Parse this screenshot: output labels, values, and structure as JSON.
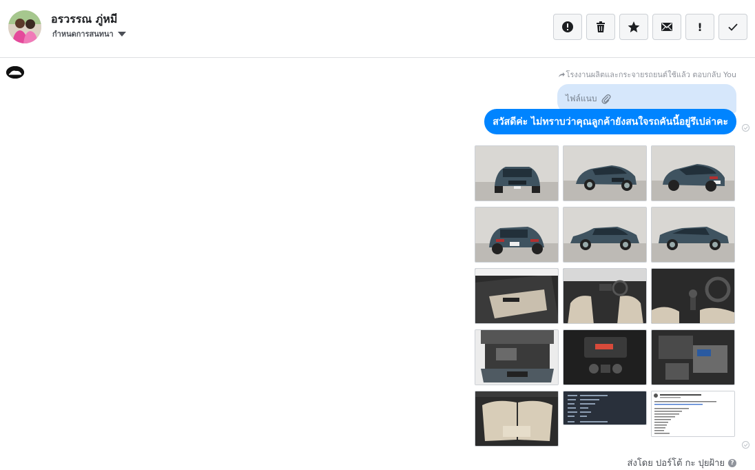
{
  "header": {
    "contact_name": "อรวรรณ ภู่หมี",
    "assign_label": "กำหนดการสนทนา",
    "toolbar": [
      {
        "icon": "alert-circle-icon",
        "name": "spam-button"
      },
      {
        "icon": "trash-icon",
        "name": "delete-button"
      },
      {
        "icon": "star-icon",
        "name": "star-button"
      },
      {
        "icon": "envelope-icon",
        "name": "mark-unread-button"
      },
      {
        "icon": "exclamation-icon",
        "name": "follow-up-button"
      },
      {
        "icon": "check-icon",
        "name": "mark-done-button"
      }
    ]
  },
  "thread": {
    "reply_note": "โรงงานผลิตและกระจายรถยนต์ใช้แล้ว ตอบกลับ You",
    "attachment_label": "ไฟล์แนบ",
    "message_text": "สวัสดีค่ะ ไม่ทราบว่าคุณลูกค้ายังสนใจรถคันนี้อยู่รึเปล่าคะ",
    "photos": [
      {
        "icon": "car-front-photo"
      },
      {
        "icon": "car-front-angle-photo"
      },
      {
        "icon": "car-rear-angle-photo"
      },
      {
        "icon": "car-rear-photo"
      },
      {
        "icon": "car-side-photo"
      },
      {
        "icon": "car-side-photo"
      },
      {
        "icon": "car-door-interior-photo"
      },
      {
        "icon": "car-dashboard-photo"
      },
      {
        "icon": "car-gearshift-photo"
      },
      {
        "icon": "car-engine-bay-photo"
      },
      {
        "icon": "car-console-photo"
      },
      {
        "icon": "car-engine-photo"
      },
      {
        "icon": "car-rear-seat-photo"
      },
      {
        "icon": "spec-screenshot-photo"
      },
      {
        "icon": "post-screenshot-photo"
      }
    ],
    "sent_by": "ส่งโดย ปอร์โต้ กะ ปุยฝ้าย"
  },
  "colors": {
    "accent": "#0084ff",
    "attachment_bubble": "#d6e7fb",
    "car_body": "#3f5360",
    "border": "#dddfe2"
  }
}
